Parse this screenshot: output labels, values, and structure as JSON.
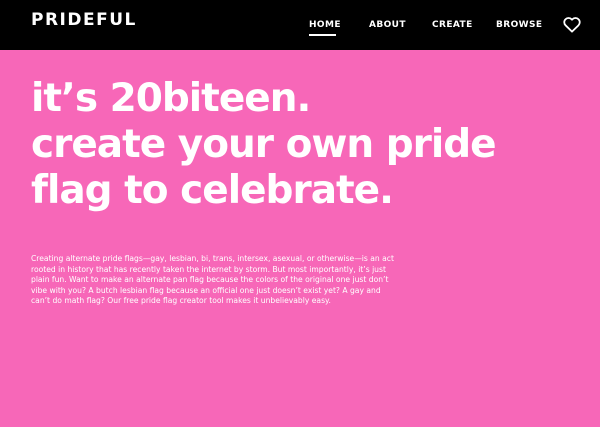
{
  "brand": {
    "name": "PRIDEFUL"
  },
  "nav": {
    "items": [
      {
        "label": "HOME",
        "active": true
      },
      {
        "label": "ABOUT",
        "active": false
      },
      {
        "label": "CREATE",
        "active": false
      },
      {
        "label": "BROWSE",
        "active": false
      }
    ],
    "favorites_icon": "heart-outline-icon"
  },
  "hero": {
    "headline_lines": [
      "it’s 20biteen.",
      "create your own pride",
      "flag to celebrate."
    ],
    "intro": "Creating alternate pride flags—gay, lesbian, bi, trans, intersex, asexual, or otherwise—is an act rooted in history that has recently taken the internet by storm. But most importantly, it’s just plain fun. Want to make an alternate pan flag because the colors of the original one just don’t vibe with you? A butch lesbian flag because an official one just doesn’t exist yet? A gay and can’t do math flag? Our free pride flag creator tool makes it unbelievably easy."
  },
  "colors": {
    "background": "#f767b8",
    "navbar": "#000000",
    "text": "#ffffff"
  }
}
